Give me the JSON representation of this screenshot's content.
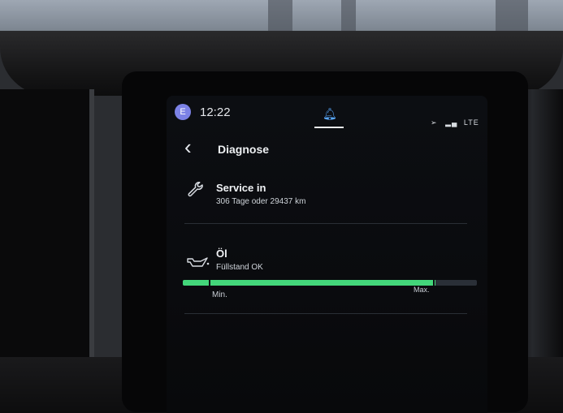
{
  "status_bar": {
    "avatar_initial": "E",
    "time": "12:22",
    "network": "LTE"
  },
  "header": {
    "back_glyph": "<",
    "title": "Diagnose"
  },
  "service": {
    "icon": "wrench-icon",
    "title": "Service in",
    "detail": "306 Tage oder 29437 km"
  },
  "oil": {
    "icon": "oil-can-icon",
    "title": "Öl",
    "status": "Füllstand OK",
    "level_fraction": 0.86,
    "min_label": "Min.",
    "max_label": "Max."
  },
  "colors": {
    "accent_green": "#43d67a",
    "avatar": "#7c82e6",
    "notification_blue": "#5aa9ff"
  }
}
